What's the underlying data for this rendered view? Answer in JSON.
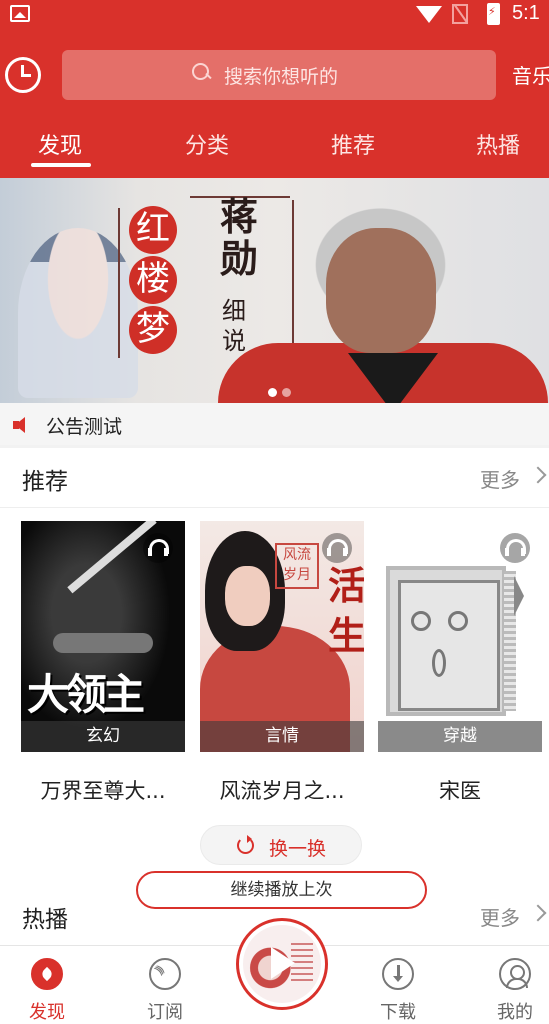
{
  "status_bar": {
    "time": "5:1"
  },
  "header": {
    "search_placeholder": "搜索你想听的",
    "music_link": "音乐"
  },
  "tabs": [
    {
      "label": "发现",
      "active": true
    },
    {
      "label": "分类",
      "active": false
    },
    {
      "label": "推荐",
      "active": false
    },
    {
      "label": "热播",
      "active": false
    }
  ],
  "banner": {
    "book_title_chars": [
      "红",
      "楼",
      "梦"
    ],
    "author": "蒋勋",
    "subtitle": "细说",
    "page_indicator": {
      "current": 1,
      "total": 2
    }
  },
  "notice": {
    "text": "公告测试"
  },
  "recommend": {
    "title": "推荐",
    "more": "更多",
    "books": [
      {
        "title": "万界至尊大...",
        "category": "玄幻",
        "cover_text": "大领主"
      },
      {
        "title": "风流岁月之...",
        "category": "言情",
        "cover_tag": "风流岁月",
        "cover_calligraphy": "活生"
      },
      {
        "title": "宋医",
        "category": "穿越"
      }
    ],
    "swap_button": "换一换"
  },
  "hot": {
    "title": "热播",
    "more": "更多"
  },
  "continue_banner": "继续播放上次",
  "tabbar": [
    {
      "label": "发现",
      "icon": "compass-icon",
      "active": true
    },
    {
      "label": "订阅",
      "icon": "rss-icon",
      "active": false
    },
    {
      "label": "下载",
      "icon": "download-icon",
      "active": false
    },
    {
      "label": "我的",
      "icon": "profile-icon",
      "active": false
    }
  ],
  "colors": {
    "brand": "#d9312b",
    "background": "#f2f2f2"
  }
}
